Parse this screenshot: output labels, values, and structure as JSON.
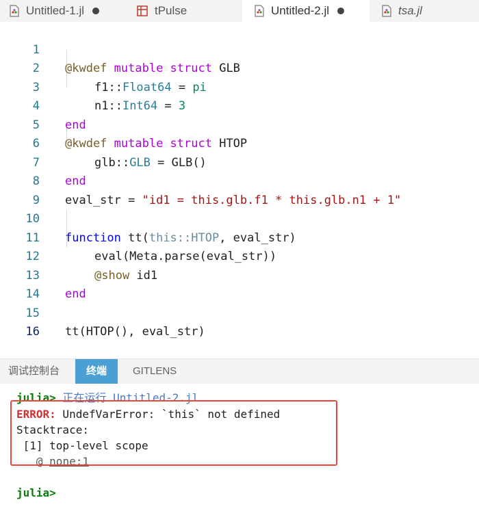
{
  "tabs": [
    {
      "label": "Untitled-1.jl",
      "modified": true
    },
    {
      "label": "tPulse",
      "modified": false
    },
    {
      "label": "Untitled-2.jl",
      "modified": true,
      "active": true
    },
    {
      "label": "tsa.jl",
      "modified": false
    }
  ],
  "code": {
    "line_numbers": [
      "1",
      "2",
      "3",
      "4",
      "5",
      "6",
      "7",
      "8",
      "9",
      "10",
      "11",
      "12",
      "13",
      "14",
      "15",
      "16"
    ],
    "l1": {
      "macro": "@kwdef",
      "kw": "mutable struct",
      "name": " GLB"
    },
    "l2": {
      "a": "f1::",
      "type": "Float64",
      "b": " = ",
      "val": "pi"
    },
    "l3": {
      "a": "n1::",
      "type": "Int64",
      "b": " = ",
      "val": "3"
    },
    "l4": {
      "kw": "end"
    },
    "l5": {
      "macro": "@kwdef",
      "kw": "mutable struct",
      "name": " HTOP"
    },
    "l6": {
      "a": "glb::",
      "type": "GLB",
      "b": " = GLB()"
    },
    "l7": {
      "kw": "end"
    },
    "l8": {
      "a": "eval_str = ",
      "str": "\"id1 = this.glb.f1 * this.glb.n1 + 1\""
    },
    "l10": {
      "kw": "function",
      "a": " tt(",
      "dim": "this::HTOP",
      "b": ", eval_str)"
    },
    "l11": {
      "a": "eval(Meta.parse(eval_str))"
    },
    "l12": {
      "macro": "@show",
      "a": " id1"
    },
    "l13": {
      "kw": "end"
    },
    "l15": {
      "a": "tt(HTOP(), eval_str)"
    }
  },
  "panel": {
    "tabs": [
      "调试控制台",
      "终端",
      "GITLENS"
    ],
    "active_tab": "终端"
  },
  "terminal": {
    "prompt": "julia>",
    "running_text": " 正在运行 Untitled-2.jl",
    "error_label": "ERROR:",
    "error_msg": " UndefVarError: `this` not defined",
    "stacktrace": "Stacktrace:",
    "frame": " [1] top-level scope",
    "frame_at": "   @ ",
    "frame_loc": "none:1",
    "prompt2": "julia>"
  },
  "colors": {
    "error_box": "#e8473c",
    "active_panel_tab": "#4a9fd4",
    "prompt": "#0b7b0b"
  }
}
